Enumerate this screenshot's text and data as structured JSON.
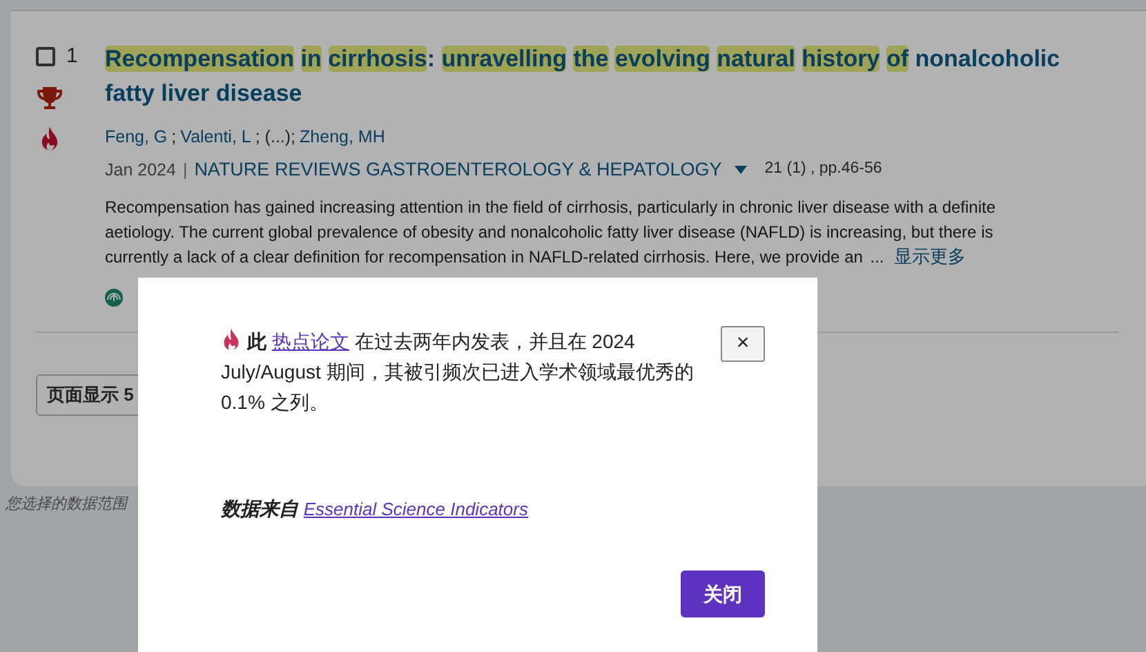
{
  "record": {
    "checked": false,
    "number": "1",
    "title_words": [
      {
        "text": "Recompensation",
        "highlighted": true
      },
      {
        "text": "in",
        "highlighted": true
      },
      {
        "text": "cirrhosis",
        "highlighted": true
      },
      {
        "text": ":",
        "highlighted": false,
        "joined": true
      },
      {
        "text": "unravelling",
        "highlighted": true
      },
      {
        "text": "the",
        "highlighted": true
      },
      {
        "text": "evolving",
        "highlighted": true
      },
      {
        "text": "natural",
        "highlighted": true
      },
      {
        "text": "history",
        "highlighted": true
      },
      {
        "text": "of",
        "highlighted": true
      },
      {
        "text": "nonalcoholic",
        "highlighted": false
      },
      {
        "text": "fatty",
        "highlighted": false
      },
      {
        "text": "liver",
        "highlighted": false
      },
      {
        "text": "disease",
        "highlighted": false
      }
    ],
    "authors": [
      {
        "text": "Feng, G",
        "kind": "link"
      },
      {
        "text": ";",
        "kind": "plain"
      },
      {
        "text": "Valenti, L",
        "kind": "link"
      },
      {
        "text": "; (...);",
        "kind": "plain"
      },
      {
        "text": "Zheng, MH",
        "kind": "link"
      }
    ],
    "date": "Jan 2024",
    "separator": "|",
    "journal": "NATURE REVIEWS GASTROENTEROLOGY & HEPATOLOGY",
    "volume": "21 (1) , pp.46-56",
    "abstract": "Recompensation has gained increasing attention in the field of cirrhosis, particularly in chronic liver disease with a definite aetiology. The current global prevalence of obesity and nonalcoholic fatty liver disease (NAFLD) is increasing, but there is currently a lack of a clear definition for recompensation in NAFLD-related cirrhosis. Here, we provide an",
    "ellipsis": "...",
    "show_more": "显示更多"
  },
  "page_size": {
    "label": "页面显示 5"
  },
  "footer_note": "您选择的数据范围",
  "dialog": {
    "prefix": "此",
    "link": "热点论文",
    "suffix": "在过去两年内发表，并且在 2024 July/August 期间，其被引频次已进入学术领域最优秀的 0.1% 之列。",
    "close_icon": "×",
    "source_label": "数据来自",
    "source_link": "Essential Science Indicators",
    "button": "关闭"
  }
}
